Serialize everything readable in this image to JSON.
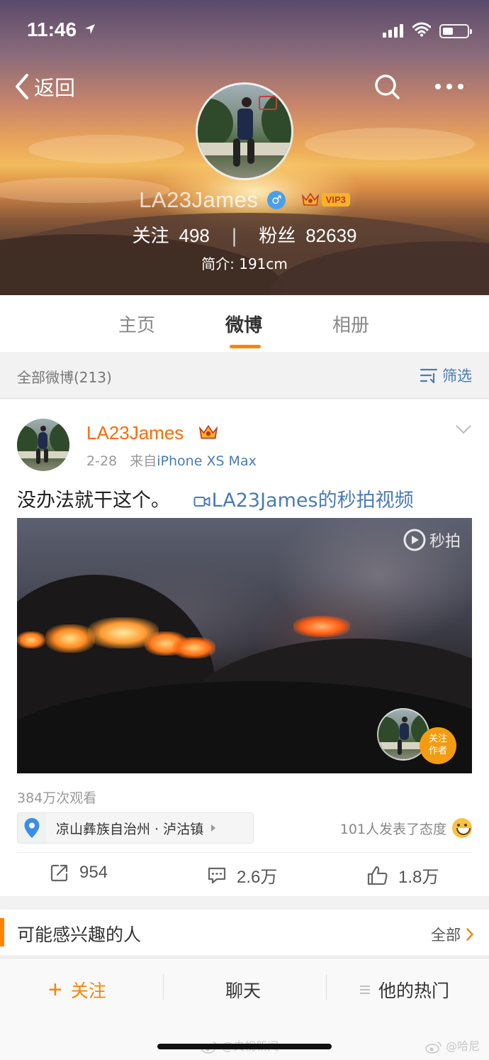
{
  "status_bar": {
    "time": "11:46"
  },
  "nav": {
    "back_label": "返回"
  },
  "profile": {
    "username": "LA23James",
    "gender_symbol": "♂",
    "vip_label": "VIP3",
    "following_label": "关注",
    "following_count": "498",
    "separator": "|",
    "followers_label": "粉丝",
    "followers_count": "82639",
    "bio": "简介: 191cm"
  },
  "tabs": [
    {
      "label": "主页",
      "active": false
    },
    {
      "label": "微博",
      "active": true
    },
    {
      "label": "相册",
      "active": false
    }
  ],
  "filter_bar": {
    "all_label": "全部微博(213)",
    "filter_label": "筛选"
  },
  "post": {
    "username": "LA23James",
    "date": "2-28",
    "from_prefix": "来自",
    "source": "iPhone XS Max",
    "text": "没办法就干这个。",
    "video_link": "LA23James的秒拍视频",
    "video_brand": "秒拍",
    "follow_author_line1": "关注",
    "follow_author_line2": "作者",
    "views": "384万次观看",
    "location": "凉山彝族自治州 · 泸沽镇",
    "attitude_text": "101人发表了态度",
    "repost_count": "954",
    "comment_count": "2.6万",
    "like_count": "1.8万"
  },
  "recommend": {
    "title": "可能感兴趣的人",
    "all_label": "全部"
  },
  "bottom_bar": {
    "follow_plus": "+",
    "follow_label": "关注",
    "chat_label": "聊天",
    "hot_label": "他的热门"
  },
  "watermarks": {
    "left": "@央视新闻",
    "right": "@哈尼"
  },
  "colors": {
    "accent_orange": "#ff8200",
    "link_blue": "#4a7bb5",
    "name_orange": "#ff6a00"
  }
}
